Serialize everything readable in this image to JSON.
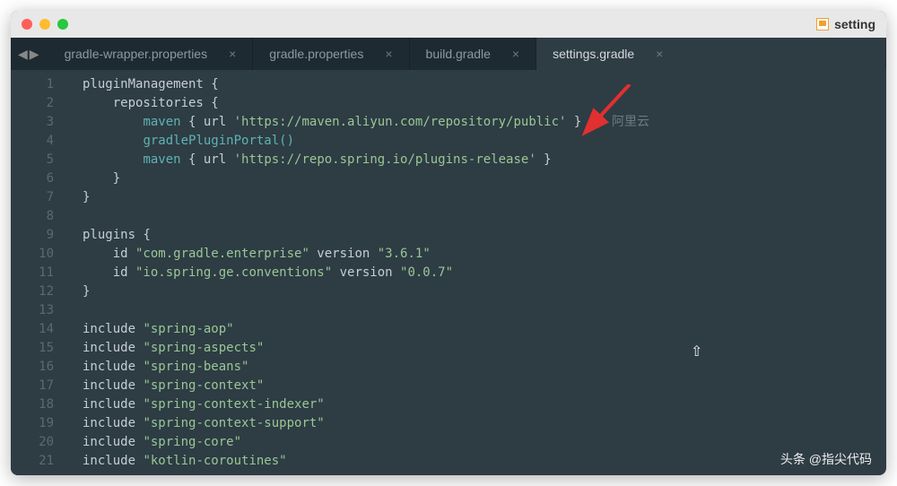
{
  "window": {
    "title": "setting"
  },
  "tabs": [
    {
      "label": "gradle-wrapper.properties",
      "active": false
    },
    {
      "label": "gradle.properties",
      "active": false
    },
    {
      "label": "build.gradle",
      "active": false
    },
    {
      "label": "settings.gradle",
      "active": true
    }
  ],
  "code": {
    "lines": [
      {
        "n": 1,
        "modified": false,
        "tokens": [
          [
            "kw",
            "pluginManagement"
          ],
          [
            "",
            " "
          ],
          [
            "paren",
            "{"
          ]
        ]
      },
      {
        "n": 2,
        "modified": false,
        "indent": 1,
        "tokens": [
          [
            "kw",
            "repositories"
          ],
          [
            "",
            ""
          ],
          [
            "paren",
            " {"
          ]
        ]
      },
      {
        "n": 3,
        "modified": true,
        "indent": 2,
        "tokens": [
          [
            "fn",
            "maven"
          ],
          [
            "",
            ""
          ],
          [
            "paren",
            " {"
          ],
          [
            "",
            ""
          ],
          [
            "kw",
            " url"
          ],
          [
            "",
            ""
          ],
          [
            "str",
            " 'https://maven.aliyun.com/repository/public'"
          ],
          [
            "",
            ""
          ],
          [
            "paren",
            " }"
          ],
          [
            "",
            ""
          ],
          [
            "comment",
            " // 阿里云"
          ]
        ]
      },
      {
        "n": 4,
        "modified": false,
        "indent": 2,
        "tokens": [
          [
            "fn",
            "gradlePluginPortal"
          ],
          [
            "paren-h",
            "()"
          ]
        ]
      },
      {
        "n": 5,
        "modified": false,
        "indent": 2,
        "tokens": [
          [
            "fn",
            "maven"
          ],
          [
            "paren",
            " {"
          ],
          [
            "kw",
            " url"
          ],
          [
            "str",
            " 'https://repo.spring.io/plugins-release'"
          ],
          [
            "paren",
            " }"
          ]
        ]
      },
      {
        "n": 6,
        "modified": false,
        "indent": 1,
        "tokens": [
          [
            "paren",
            "}"
          ]
        ]
      },
      {
        "n": 7,
        "modified": false,
        "tokens": [
          [
            "paren",
            "}"
          ]
        ]
      },
      {
        "n": 8,
        "modified": false,
        "tokens": [
          [
            "",
            ""
          ]
        ]
      },
      {
        "n": 9,
        "modified": false,
        "tokens": [
          [
            "kw",
            "plugins"
          ],
          [
            "paren",
            " {"
          ]
        ]
      },
      {
        "n": 10,
        "modified": false,
        "indent": 1,
        "tokens": [
          [
            "kw",
            "id"
          ],
          [
            "str",
            " \"com.gradle.enterprise\""
          ],
          [
            "kw",
            " version"
          ],
          [
            "str",
            " \"3.6.1\""
          ]
        ]
      },
      {
        "n": 11,
        "modified": false,
        "indent": 1,
        "tokens": [
          [
            "kw",
            "id"
          ],
          [
            "str",
            " \"io.spring.ge.conventions\""
          ],
          [
            "kw",
            " version"
          ],
          [
            "str",
            " \"0.0.7\""
          ]
        ]
      },
      {
        "n": 12,
        "modified": false,
        "tokens": [
          [
            "paren",
            "}"
          ]
        ]
      },
      {
        "n": 13,
        "modified": false,
        "tokens": [
          [
            "",
            ""
          ]
        ]
      },
      {
        "n": 14,
        "modified": false,
        "tokens": [
          [
            "kw",
            "include"
          ],
          [
            "str",
            " \"spring-aop\""
          ]
        ]
      },
      {
        "n": 15,
        "modified": false,
        "tokens": [
          [
            "kw",
            "include"
          ],
          [
            "str",
            " \"spring-aspects\""
          ]
        ]
      },
      {
        "n": 16,
        "modified": false,
        "tokens": [
          [
            "kw",
            "include"
          ],
          [
            "str",
            " \"spring-beans\""
          ]
        ]
      },
      {
        "n": 17,
        "modified": false,
        "tokens": [
          [
            "kw",
            "include"
          ],
          [
            "str",
            " \"spring-context\""
          ]
        ]
      },
      {
        "n": 18,
        "modified": false,
        "tokens": [
          [
            "kw",
            "include"
          ],
          [
            "str",
            " \"spring-context-indexer\""
          ]
        ]
      },
      {
        "n": 19,
        "modified": false,
        "tokens": [
          [
            "kw",
            "include"
          ],
          [
            "str",
            " \"spring-context-support\""
          ]
        ]
      },
      {
        "n": 20,
        "modified": false,
        "tokens": [
          [
            "kw",
            "include"
          ],
          [
            "str",
            " \"spring-core\""
          ]
        ]
      },
      {
        "n": 21,
        "modified": false,
        "tokens": [
          [
            "kw",
            "include"
          ],
          [
            "str",
            " \"kotlin-coroutines\""
          ]
        ]
      }
    ]
  },
  "watermark": "头条 @指尖代码",
  "nav": {
    "back": "◀",
    "forward": "▶"
  }
}
